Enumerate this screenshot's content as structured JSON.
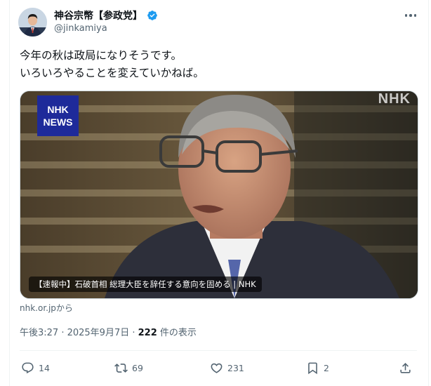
{
  "author": {
    "display_name": "神谷宗幣【参政党】",
    "handle": "@jinkamiya"
  },
  "tweet": {
    "line1": "今年の秋は政局になりそうです。",
    "line2": "いろいろやることを変えていかねば。"
  },
  "media": {
    "badge_line1": "NHK",
    "badge_line2": "NEWS",
    "watermark": "NHK",
    "caption": "【速報中】石破首相 総理大臣を辞任する意向を固める | NHK"
  },
  "link_source": "nhk.or.jpから",
  "meta": {
    "timestamp": "午後3:27 · 2025年9月7日 · ",
    "views_count": "222",
    "views_label": " 件の表示"
  },
  "actions": {
    "replies": "14",
    "retweets": "69",
    "likes": "231",
    "bookmarks": "2"
  },
  "colors": {
    "text_primary": "#0f1419",
    "text_secondary": "#536471",
    "verified_blue": "#1d9bf0",
    "nhk_badge": "#1e2a9a"
  },
  "icons": [
    "verified-badge-icon",
    "more-options-icon",
    "reply-icon",
    "retweet-icon",
    "like-icon",
    "bookmark-icon",
    "share-icon"
  ]
}
